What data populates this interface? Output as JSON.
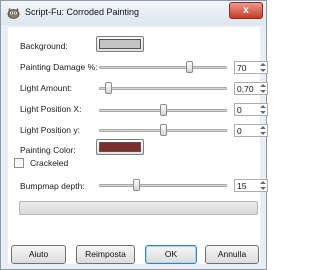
{
  "window": {
    "title": "Script-Fu: Corroded Painting",
    "close_label": "x"
  },
  "form": {
    "background": {
      "label": "Background:",
      "color": "#c4c4c4"
    },
    "painting_damage": {
      "label": "Painting Damage %:",
      "value": "70",
      "min": 0,
      "max": 100,
      "level": 70
    },
    "light_amount": {
      "label": "Light Amount:",
      "value": "0,70",
      "min": 0,
      "max": 10,
      "level": 0.7
    },
    "light_position_x": {
      "label": "Light Position X:",
      "value": "0",
      "min": -1,
      "max": 1,
      "level": 0
    },
    "light_position_y": {
      "label": "Light Position y:",
      "value": "0",
      "min": -1,
      "max": 1,
      "level": 0
    },
    "painting_color": {
      "label": "Painting Color:",
      "color": "#7b2e2e"
    },
    "crackeled": {
      "label": "Crackeled",
      "checked": false
    },
    "bumpmap_depth": {
      "label": "Bumpmap depth:",
      "value": "15",
      "min": 1,
      "max": 50,
      "level": 15
    }
  },
  "progress": {
    "fraction": 0
  },
  "buttons": {
    "help": "Aiuto",
    "reset": "Reimposta",
    "ok": "OK",
    "cancel": "Annulla"
  },
  "colors": {
    "accent": "#3c7fb1",
    "close": "#c43c27"
  }
}
